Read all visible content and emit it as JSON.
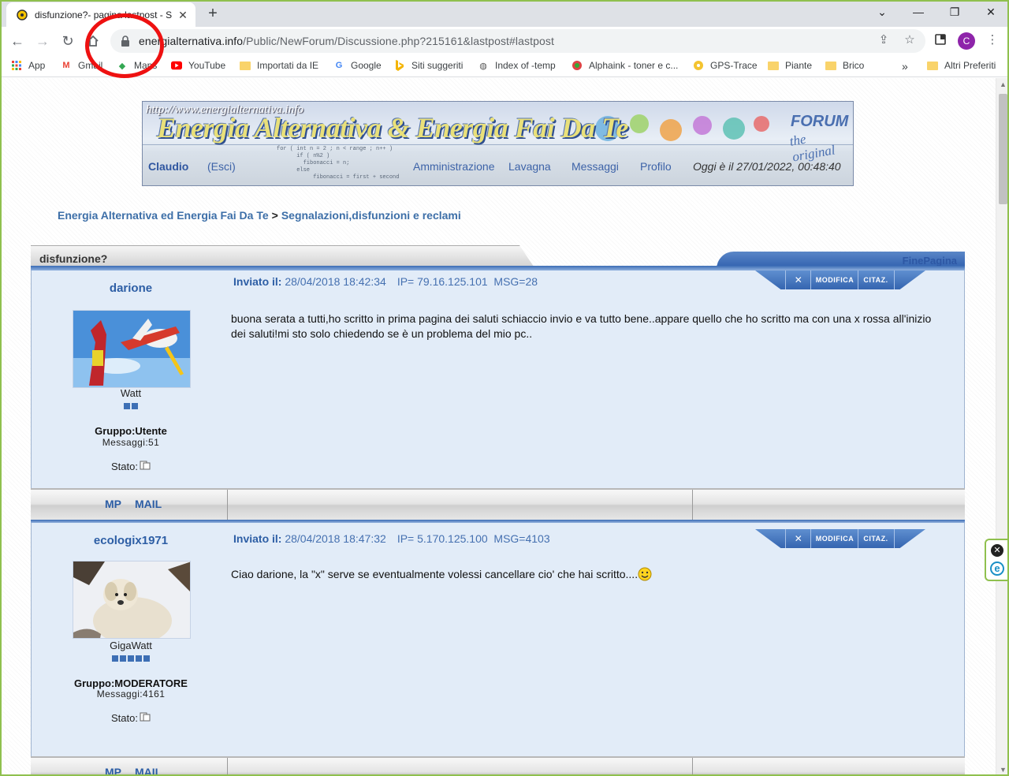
{
  "browser": {
    "tab_title": "disfunzione?- pagina lastpost - S",
    "new_tab_symbol": "+",
    "url_host": "energialternativa.info",
    "url_path": "/Public/NewForum/Discussione.php?215161&lastpost#lastpost",
    "profile_initial": "C",
    "icons": [
      "back-icon",
      "forward-icon",
      "reload-icon",
      "home-icon",
      "lock-icon",
      "share-icon",
      "star-icon",
      "extensions-icon",
      "menu-icon"
    ]
  },
  "bookmarks": {
    "items": [
      {
        "label": "App",
        "icon": "apps-grid-icon"
      },
      {
        "label": "Gmail",
        "icon": "gmail-icon"
      },
      {
        "label": "Maps",
        "icon": "maps-icon"
      },
      {
        "label": "YouTube",
        "icon": "youtube-icon"
      },
      {
        "label": "Importati da IE",
        "icon": "folder-icon"
      },
      {
        "label": "Google",
        "icon": "google-icon"
      },
      {
        "label": "Siti suggeriti",
        "icon": "bing-icon"
      },
      {
        "label": "Index of -temp",
        "icon": "globe-icon"
      },
      {
        "label": "Alphaink - toner e c...",
        "icon": "site-icon"
      },
      {
        "label": "GPS-Trace",
        "icon": "site-icon"
      },
      {
        "label": "Piante",
        "icon": "folder-icon"
      },
      {
        "label": "Brico",
        "icon": "folder-icon"
      }
    ],
    "overflow": "»",
    "other": "Altri Preferiti"
  },
  "banner": {
    "url": "http://www.energialternativa.info",
    "title": "Energia Alternativa & Energia Fai Da Te",
    "forum": "FORUM",
    "forum_sub": "the original",
    "user": "Claudio",
    "logout": "(Esci)",
    "nav": [
      "Amministrazione",
      "Lavagna",
      "Messaggi",
      "Profilo"
    ],
    "date": "Oggi è il 27/01/2022, 00:48:40"
  },
  "breadcrumb": {
    "root": "Energia Alternativa ed Energia Fai Da Te",
    "separator": ">",
    "section": "Segnalazioni,disfunzioni e reclami"
  },
  "thread": {
    "title": "disfunzione?",
    "end_link": "FinePagina",
    "actions": {
      "delete": "✕",
      "edit": "MODIFICA",
      "quote": "CITAZ."
    },
    "posts": [
      {
        "user": "darione",
        "rank": "Watt",
        "stars": 2,
        "group": "Gruppo:Utente",
        "messages": "Messaggi:51",
        "status": "Stato:",
        "sent_label": "Inviato il:",
        "date": "28/04/2018 18:42:34",
        "ip": "IP= 79.16.125.101",
        "msg": "MSG=28",
        "body": "buona serata a tutti,ho scritto in prima pagina dei saluti schiaccio invio e va tutto bene..appare quello che ho scritto ma con una x rossa all'inizio dei saluti!mi sto solo chiedendo se è un problema del mio pc..",
        "links": {
          "pm": "MP",
          "mail": "MAIL"
        }
      },
      {
        "user": "ecologix1971",
        "rank": "GigaWatt",
        "stars": 5,
        "group": "Gruppo:MODERATORE",
        "messages": "Messaggi:4161",
        "status": "Stato:",
        "sent_label": "Inviato il:",
        "date": "28/04/2018 18:47:32",
        "ip": "IP= 5.170.125.100",
        "msg": "MSG=4103",
        "body": "Ciao darione, la \"x\" serve se eventualmente volessi cancellare cio' che hai scritto....",
        "links": {
          "pm": "MP",
          "mail": "MAIL"
        }
      }
    ]
  },
  "colors": {
    "accent_blue": "#2d5ea5",
    "post_bg": "#e2ecf8",
    "annotation_red": "#e11111",
    "frame_green": "#8fc04e"
  }
}
